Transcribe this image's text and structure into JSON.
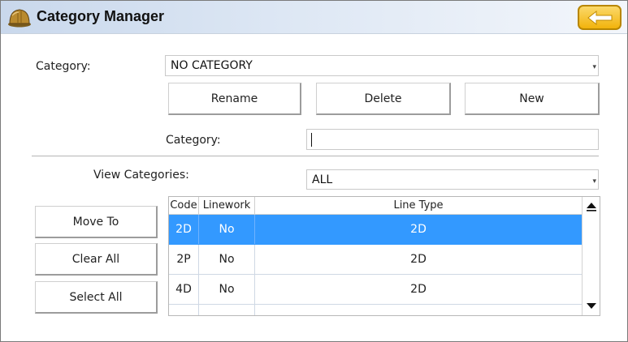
{
  "window": {
    "title": "Category Manager"
  },
  "header": {
    "title_icon": "hardhat-icon",
    "back_icon": "back-arrow-icon"
  },
  "form": {
    "category_label": "Category:",
    "category_value": "NO CATEGORY",
    "rename_label": "Rename",
    "delete_label": "Delete",
    "new_label": "New",
    "new_category_label": "Category:",
    "new_category_value": "",
    "view_label": "View Categories:",
    "view_value": "ALL"
  },
  "side_buttons": {
    "move_to": "Move To",
    "clear_all": "Clear All",
    "select_all": "Select All"
  },
  "table": {
    "headers": [
      "Code",
      "Linework",
      "Line Type"
    ],
    "rows": [
      {
        "code": "2D",
        "linework": "No",
        "line_type": "2D",
        "selected": true
      },
      {
        "code": "2P",
        "linework": "No",
        "line_type": "2D",
        "selected": false
      },
      {
        "code": "4D",
        "linework": "No",
        "line_type": "2D",
        "selected": false
      }
    ]
  },
  "colors": {
    "selection": "#3399ff",
    "title_gradient_start": "#c9d8ec",
    "back_button": "#f2b30c"
  }
}
